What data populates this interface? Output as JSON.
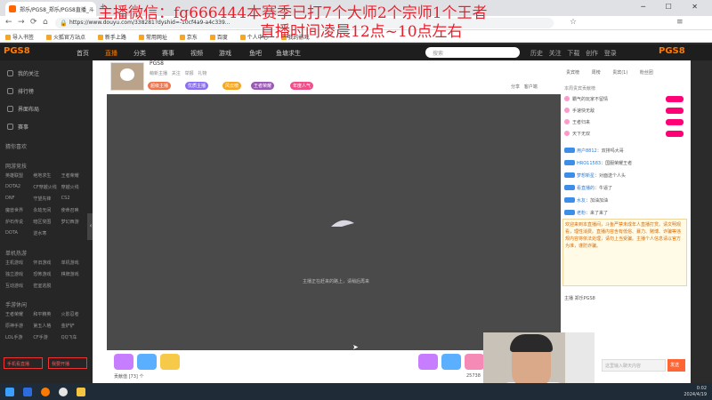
{
  "browser": {
    "tab_title": "郑乐/PGS8_郑乐/PGS8直播_斗",
    "new_tab": "+",
    "url": "https://www.douyu.com/338281?dyshid=-10cf4a9-a4c339...",
    "bookmarks": [
      "导入书签",
      "火狐官方站点",
      "新手上路",
      "常用网址",
      "京东",
      "百度",
      "个人中心",
      "我的游戏"
    ]
  },
  "overlay": {
    "line1": "主播微信：fg666444本赛季已打7个大师2个宗师1个王者",
    "line2": "直播时间凌晨12点~10点左右"
  },
  "site_nav": {
    "logo": "PGS8",
    "items": [
      "首页",
      "直播",
      "分类",
      "赛事",
      "视频",
      "游戏",
      "鱼吧",
      "鱼塘求生"
    ],
    "active_index": 1,
    "search_placeholder": "搜索",
    "right_items": [
      "历史",
      "关注",
      "下载",
      "创作",
      "登录"
    ],
    "badge": "PGS8"
  },
  "sidebar": {
    "top_items": [
      "我的关注",
      "排行榜",
      "界面布局",
      "赛事"
    ],
    "recommend_head": "猜你喜欢",
    "sections": [
      {
        "title": "网游竞技",
        "items": [
          "英雄联盟",
          "绝地求生",
          "王者荣耀",
          "DOTA2",
          "CF穿越火线",
          "穿越火线",
          "DNF",
          "守望先锋",
          "CS2",
          "魔兽世界",
          "永劫无间",
          "使命召唤",
          "炉石传说",
          "暗区突围",
          "梦幻西游",
          "DOTA",
          "逆水寒"
        ]
      },
      {
        "title": "单机热游",
        "items": [
          "主机游戏",
          "怀旧游戏",
          "单机游戏",
          "独立游戏",
          "恐怖游戏",
          "棋牌游戏",
          "互动游戏",
          "密室逃脱"
        ]
      },
      {
        "title": "手游休闲",
        "items": [
          "王者荣耀",
          "和平精英",
          "火影忍者",
          "原神手游",
          "第五人格",
          "金铲铲",
          "LOL手游",
          "CF手游",
          "QQ飞车"
        ]
      }
    ],
    "btn_live": "手机看直播",
    "btn_open": "我要开播"
  },
  "room": {
    "title": "PGS8",
    "meta": [
      "萌新主播",
      "关注",
      "举报",
      "礼物"
    ],
    "tags": [
      "超级主播",
      "优质主播",
      "风云榜",
      "王者荣耀",
      "年度人气"
    ],
    "tag_colors": [
      "#f0734a",
      "#8a6ef5",
      "#f5a623",
      "#9b59b6",
      "#f04f8a"
    ],
    "right_links": [
      "分享",
      "客户端"
    ],
    "loading_text": "主播正在赶来的路上，请稍后再来",
    "gift_label": "贡献值 [73] 个",
    "gift_count": "25738"
  },
  "chat": {
    "tabs": [
      "贵宾榜",
      "周榜",
      "贵宾(1)",
      "粉丝团"
    ],
    "rank_head": "本周贵宾贡献榜",
    "rank": [
      "霸气的玩家不留情",
      "手速快无敌",
      "王者归来",
      "天下无双"
    ],
    "messages": [
      {
        "name": "用户8812",
        "text": "双排吗大哥"
      },
      {
        "name": "HRO11583",
        "text": "国服荣耀王者"
      },
      {
        "name": "梦想新星",
        "text": "对面送个人头"
      },
      {
        "name": "看直播的",
        "text": "牛逼了"
      },
      {
        "name": "水友",
        "text": "加油加油"
      },
      {
        "name": "老粉",
        "text": "来了来了"
      }
    ],
    "notice": "欢迎来到本直播间，斗鱼严禁未成年人直播打赏。请文明观看，理性消费。直播内容含有低俗、暴力、赌博、诈骗等违规内容将依法处理，请勿上当受骗。主播个人信息请以官方为准，谨防诈骗。",
    "host_row": "主播 郑乐PGS8",
    "input_placeholder": "这里输入聊天内容",
    "send": "发送"
  },
  "taskbar": {
    "time": "0:02",
    "date": "2024/4/19"
  }
}
